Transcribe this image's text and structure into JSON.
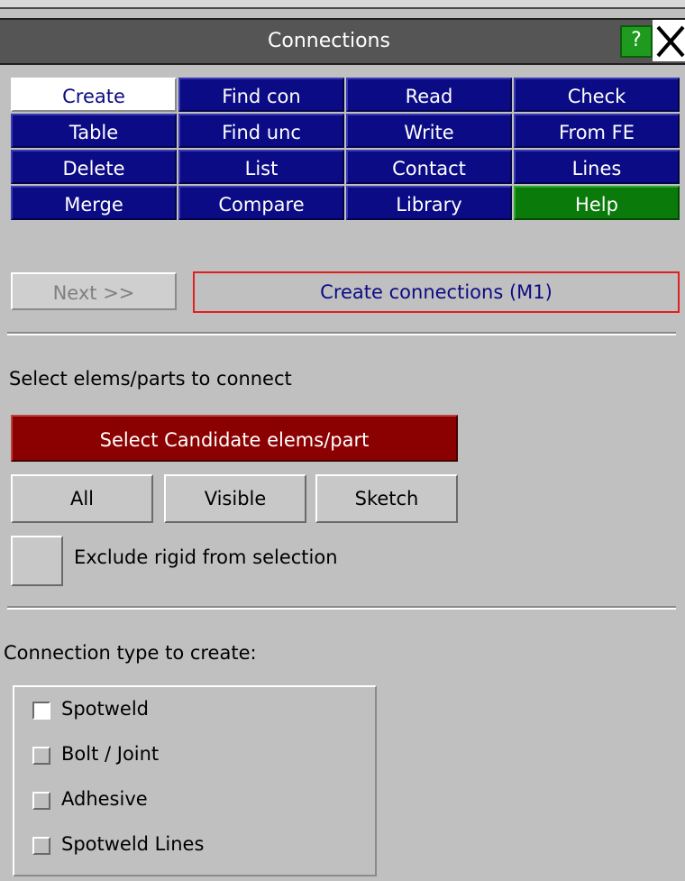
{
  "window": {
    "title": "Connections",
    "help_label": "?"
  },
  "menu": [
    {
      "label": "Create",
      "state": "active"
    },
    {
      "label": "Find con"
    },
    {
      "label": "Read"
    },
    {
      "label": "Check"
    },
    {
      "label": "Table"
    },
    {
      "label": "Find unc"
    },
    {
      "label": "Write"
    },
    {
      "label": "From FE"
    },
    {
      "label": "Delete"
    },
    {
      "label": "List"
    },
    {
      "label": "Contact"
    },
    {
      "label": "Lines"
    },
    {
      "label": "Merge"
    },
    {
      "label": "Compare"
    },
    {
      "label": "Library"
    },
    {
      "label": "Help",
      "color": "#0a7a0a"
    }
  ],
  "actions": {
    "next_label": "Next >>",
    "create_label": "Create connections (M1)"
  },
  "selection": {
    "heading": "Select elems/parts to connect",
    "candidate_button": "Select Candidate elems/part",
    "all_label": "All",
    "visible_label": "Visible",
    "sketch_label": "Sketch",
    "exclude_label": "Exclude rigid from selection"
  },
  "connection_type": {
    "heading": "Connection type to create:",
    "options": [
      {
        "label": "Spotweld",
        "checked": true
      },
      {
        "label": "Bolt / Joint",
        "checked": false
      },
      {
        "label": "Adhesive",
        "checked": false
      },
      {
        "label": "Spotweld Lines",
        "checked": false
      }
    ]
  },
  "colors": {
    "panel_bg": "#c0c0c0",
    "menu_blue": "#0b0b85",
    "help_green": "#0a7a0a",
    "candidate_red": "#8b0000",
    "highlight_border": "#e02020"
  }
}
